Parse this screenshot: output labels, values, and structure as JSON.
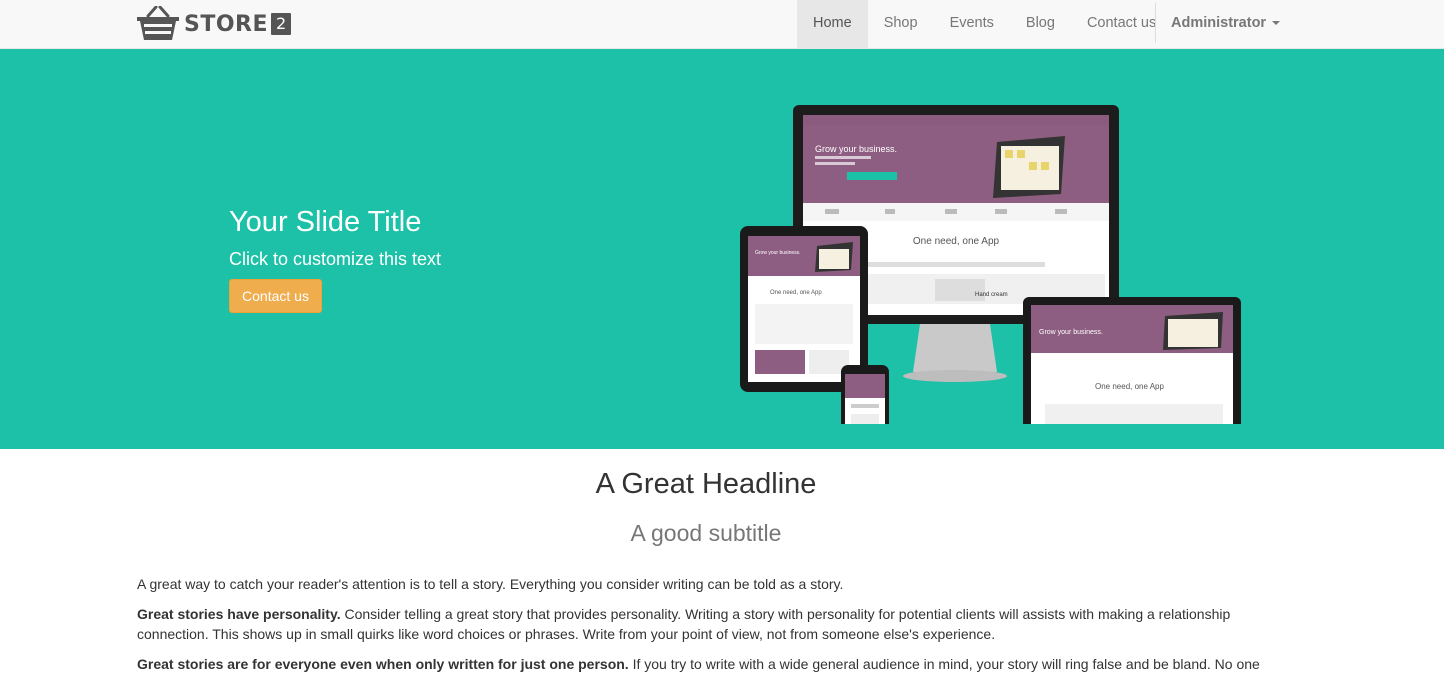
{
  "brand": {
    "name": "STORE",
    "number": "2"
  },
  "nav": {
    "items": [
      {
        "label": "Home",
        "active": true
      },
      {
        "label": "Shop",
        "active": false
      },
      {
        "label": "Events",
        "active": false
      },
      {
        "label": "Blog",
        "active": false
      },
      {
        "label": "Contact us",
        "active": false
      }
    ],
    "user_menu": "Administrator"
  },
  "hero": {
    "title": "Your Slide Title",
    "text": "Click to customize this text",
    "button": "Contact us",
    "background_color": "#1cc1a7",
    "button_color": "#f0ad4e",
    "mockup": {
      "tagline": "Grow your business.",
      "section_heading": "One need, one App",
      "product": "Hand cream"
    }
  },
  "content": {
    "headline": "A Great Headline",
    "subtitle": "A good subtitle",
    "p1": "A great way to catch your reader's attention is to tell a story. Everything you consider writing can be told as a story.",
    "p2_bold": "Great stories have personality.",
    "p2": " Consider telling a great story that provides personality. Writing a story with personality for potential clients will assists with making a relationship connection. This shows up in small quirks like word choices or phrases. Write from your point of view, not from someone else's experience.",
    "p3_bold": "Great stories are for everyone even when only written for just one person.",
    "p3": " If you try to write with a wide general audience in mind, your story will ring false and be bland. No one"
  }
}
